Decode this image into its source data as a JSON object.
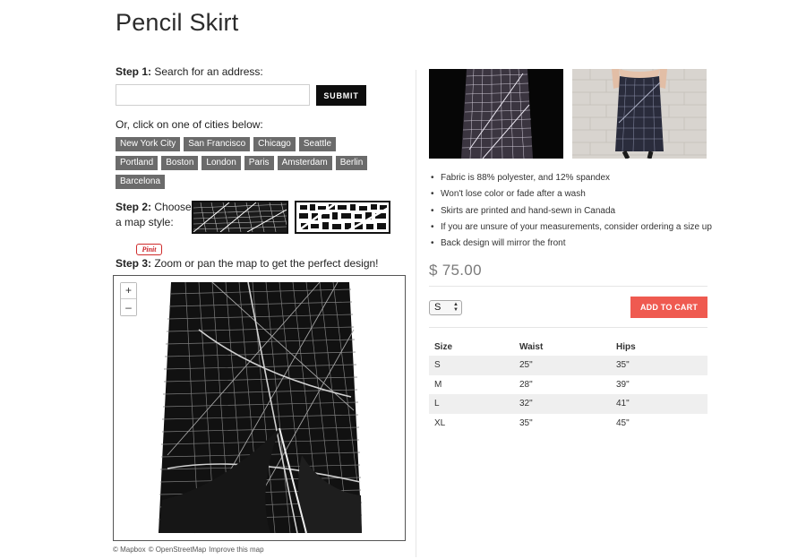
{
  "page": {
    "title": "Pencil Skirt"
  },
  "step1": {
    "label_bold": "Step 1:",
    "label_text": " Search for an address:",
    "search_value": "",
    "search_placeholder": "",
    "submit_label": "SUBMIT",
    "cities_prompt": "Or, click on one of cities below:",
    "cities": [
      "New York City",
      "San Francisco",
      "Chicago",
      "Seattle",
      "Portland",
      "Boston",
      "London",
      "Paris",
      "Amsterdam",
      "Berlin",
      "Barcelona"
    ]
  },
  "step2": {
    "label_bold": "Step 2:",
    "label_text": " Choose",
    "label_text2": "a map style:"
  },
  "pinit": {
    "label": "Pinit"
  },
  "step3": {
    "label_bold": "Step 3:",
    "label_text": " Zoom or pan the map to get the perfect design!"
  },
  "map": {
    "zoom_in": "+",
    "zoom_out": "–",
    "credits": [
      "© Mapbox",
      "© OpenStreetMap",
      "Improve this map"
    ]
  },
  "product": {
    "photos": [
      "skirt-front-dark-photo",
      "skirt-worn-photo"
    ],
    "features": [
      "Fabric is 88% polyester, and 12% spandex",
      "Won't lose color or fade after a wash",
      "Skirts are printed and hand-sewn in Canada",
      "If you are unsure of your measurements, consider ordering a size up",
      "Back design will mirror the front"
    ],
    "price": "$ 75.00",
    "size_selected": "S",
    "add_to_cart": "ADD TO CART"
  },
  "size_table": {
    "headers": [
      "Size",
      "Waist",
      "Hips"
    ],
    "rows": [
      [
        "S",
        "25\"",
        "35\""
      ],
      [
        "M",
        "28\"",
        "39\""
      ],
      [
        "L",
        "32\"",
        "41\""
      ],
      [
        "XL",
        "35\"",
        "45\""
      ]
    ]
  },
  "colors": {
    "accent": "#ef5a50",
    "tag_bg": "#6b6b6b",
    "button_dark": "#0d0d0d"
  }
}
